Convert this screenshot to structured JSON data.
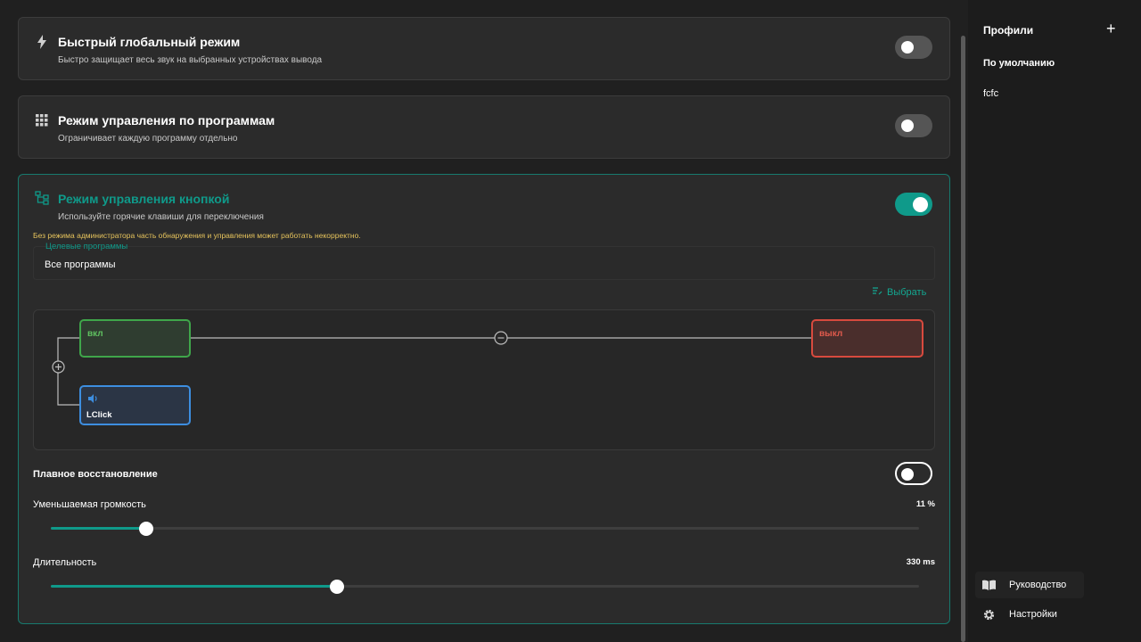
{
  "cards": {
    "global": {
      "title": "Быстрый глобальный режим",
      "subtitle": "Быстро защищает весь звук на выбранных устройствах вывода",
      "enabled": false,
      "icon": "lightning-icon"
    },
    "per_app": {
      "title": "Режим управления по программам",
      "subtitle": "Ограничивает каждую программу отдельно",
      "enabled": false,
      "icon": "grid-icon"
    },
    "button": {
      "title": "Режим управления кнопкой",
      "subtitle": "Используйте горячие клавиши для переключения",
      "enabled": true,
      "icon": "flow-icon",
      "warning": "Без режима администратора часть обнаружения и управления может работать некорректно.",
      "target_label": "Целевые программы",
      "target_value": "Все программы",
      "select_label": "Выбрать",
      "graph": {
        "on_label": "вкл",
        "off_label": "выкл",
        "key_label": "LClick",
        "key_icon": "speaker-icon"
      },
      "smooth_restore": {
        "label": "Плавное восстановление",
        "enabled": false
      },
      "volume": {
        "label": "Уменьшаемая громкость",
        "display": "11 %",
        "value": 11,
        "max": 100
      },
      "duration": {
        "label": "Длительность",
        "display": "330 ms",
        "fraction": 0.33
      }
    }
  },
  "sidebar": {
    "title": "Профили",
    "add_icon": "+",
    "profiles": [
      "По умолчанию",
      "fcfc"
    ],
    "guide_label": "Руководство",
    "settings_label": "Настройки"
  },
  "colors": {
    "accent": "#0f9a8a",
    "on_node": "#3fa64a",
    "off_node": "#d84a3e",
    "key_node": "#3d8ee0",
    "warning": "#e6c35c"
  }
}
